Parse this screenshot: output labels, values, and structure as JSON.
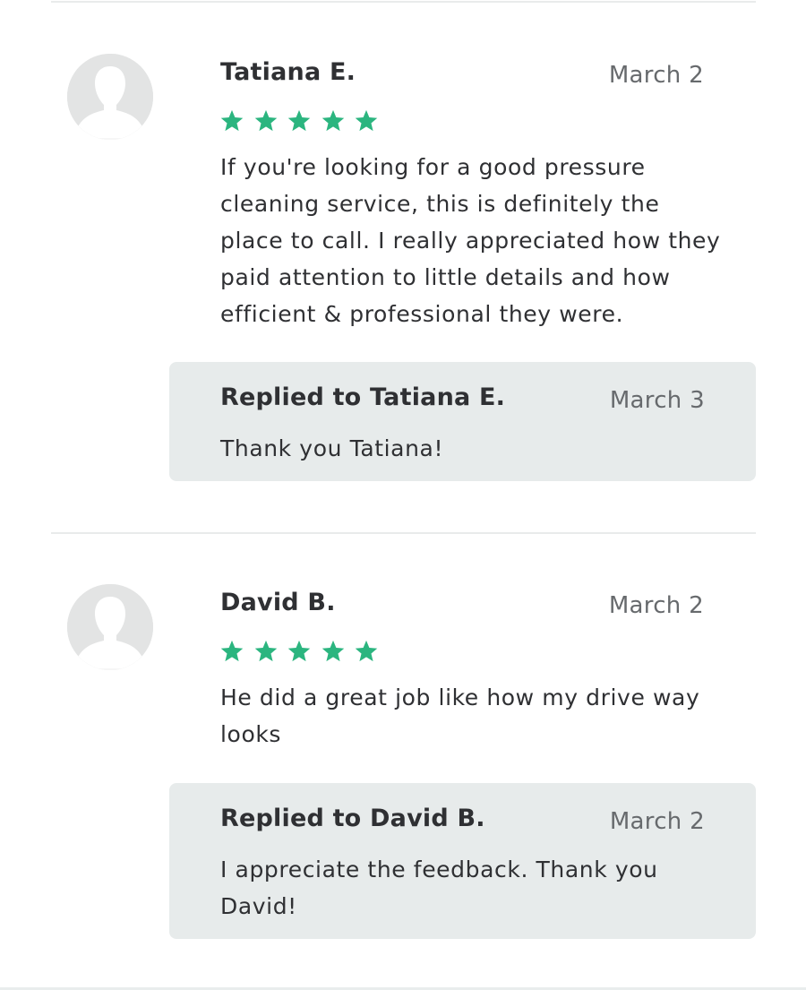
{
  "colors": {
    "star": "#2bb57f",
    "divider": "#e9ebeb",
    "reply_background": "#e7ebeb",
    "avatar_background": "#e3e4e4",
    "date_text": "#676a6d"
  },
  "reviews": [
    {
      "avatar_icon": "user-silhouette-icon",
      "name": "Tatiana E.",
      "date": "March 2",
      "rating": 5,
      "text": "If you're looking for a good pressure cleaning service, this is definitely the place to call. I really appreciated how they paid attention to little details and how efficient & professional they were.",
      "reply": {
        "title": "Replied to Tatiana E.",
        "date": "March 3",
        "text": "Thank you Tatiana!"
      }
    },
    {
      "avatar_icon": "user-silhouette-icon",
      "name": "David B.",
      "date": "March 2",
      "rating": 5,
      "text": "He did a great job like how my drive way looks",
      "reply": {
        "title": "Replied to David B.",
        "date": "March 2",
        "text": "I appreciate the feedback. Thank you David!"
      }
    }
  ]
}
